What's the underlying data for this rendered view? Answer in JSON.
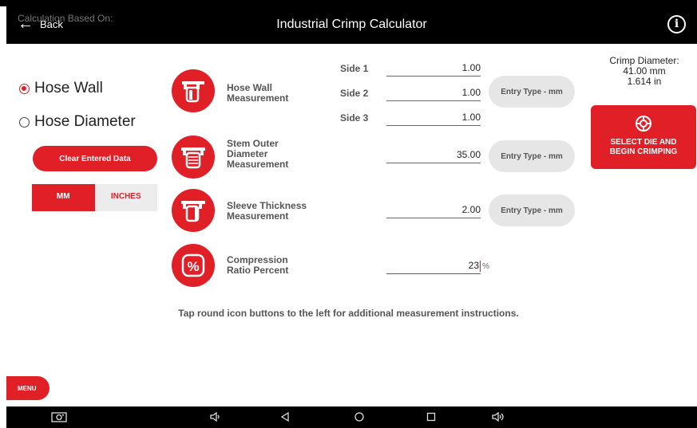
{
  "header": {
    "back_label": "Back",
    "title": "Industrial Crimp Calculator",
    "info_icon": "info-icon"
  },
  "left": {
    "calc_label": "Calculation Based On:",
    "options": [
      {
        "label": "Hose Wall",
        "selected": true
      },
      {
        "label": "Hose Diameter",
        "selected": false
      }
    ],
    "clear_label": "Clear Entered Data",
    "units": {
      "mm_label": "MM",
      "inches_label": "INCHES",
      "selected": "MM"
    }
  },
  "measurements": {
    "hose_wall": {
      "label_line1": "Hose Wall",
      "label_line2": "Measurement",
      "sides": [
        {
          "label": "Side 1",
          "value": "1.00"
        },
        {
          "label": "Side 2",
          "value": "1.00"
        },
        {
          "label": "Side 3",
          "value": "1.00"
        }
      ],
      "entry_type": "Entry Type - mm"
    },
    "stem": {
      "label_line1": "Stem Outer",
      "label_line2": "Diameter",
      "label_line3": "Measurement",
      "value": "35.00",
      "entry_type": "Entry Type - mm"
    },
    "sleeve": {
      "label_line1": "Sleeve Thickness",
      "label_line2": "Measurement",
      "value": "2.00",
      "entry_type": "Entry Type - mm"
    },
    "compression": {
      "label_line1": "Compression",
      "label_line2": "Ratio Percent",
      "value": "23",
      "unit": "%"
    }
  },
  "crimp": {
    "label": "Crimp Diameter:",
    "mm": "41.00 mm",
    "inches": "1.614 in"
  },
  "select_die": {
    "line1": "SELECT DIE AND",
    "line2": "BEGIN CRIMPING"
  },
  "hint": "Tap round icon buttons to the left for additional measurement instructions.",
  "menu_label": "MENU",
  "colors": {
    "accent": "#e01f26",
    "bar": "#000000",
    "entry_button": "#e6e6e6"
  }
}
